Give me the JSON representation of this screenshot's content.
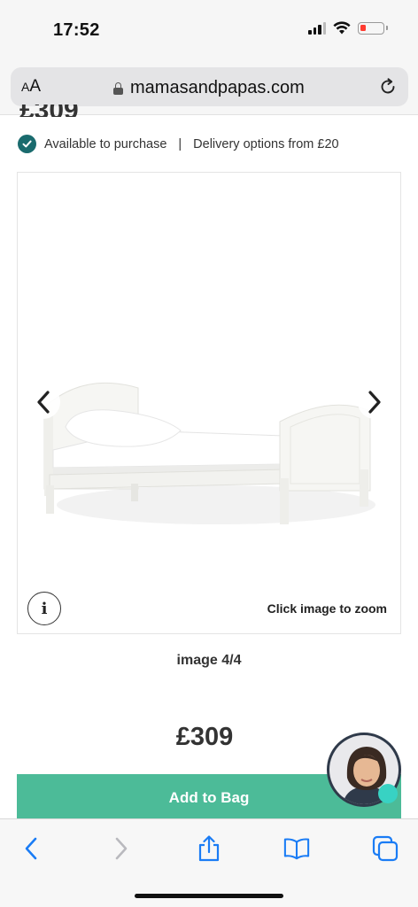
{
  "status_bar": {
    "time": "17:52"
  },
  "browser": {
    "text_size_label_small": "A",
    "text_size_label_large": "A",
    "url": "mamasandpapas.com"
  },
  "product": {
    "partial_price": "£309",
    "availability": "Available to purchase",
    "delivery": "Delivery options from £20",
    "separator": "|",
    "zoom_hint": "Click image to zoom",
    "info_label": "i",
    "image_counter": "image 4/4",
    "image_index": 4,
    "image_total": 4,
    "price": "£309",
    "add_to_bag": "Add to Bag"
  },
  "colors": {
    "accent_green": "#4cbb98",
    "check_teal": "#1a6b6e",
    "ios_blue": "#1a7cf5",
    "chat_dot": "#38d2c3"
  },
  "icons": {
    "check": "checkmark-circle-icon",
    "lock": "lock-icon",
    "reload": "reload-icon",
    "prev": "chevron-left-icon",
    "next": "chevron-right-icon",
    "info": "info-icon",
    "back": "back-arrow-icon",
    "forward": "forward-arrow-icon",
    "share": "share-icon",
    "bookmarks": "book-icon",
    "tabs": "tabs-icon"
  }
}
